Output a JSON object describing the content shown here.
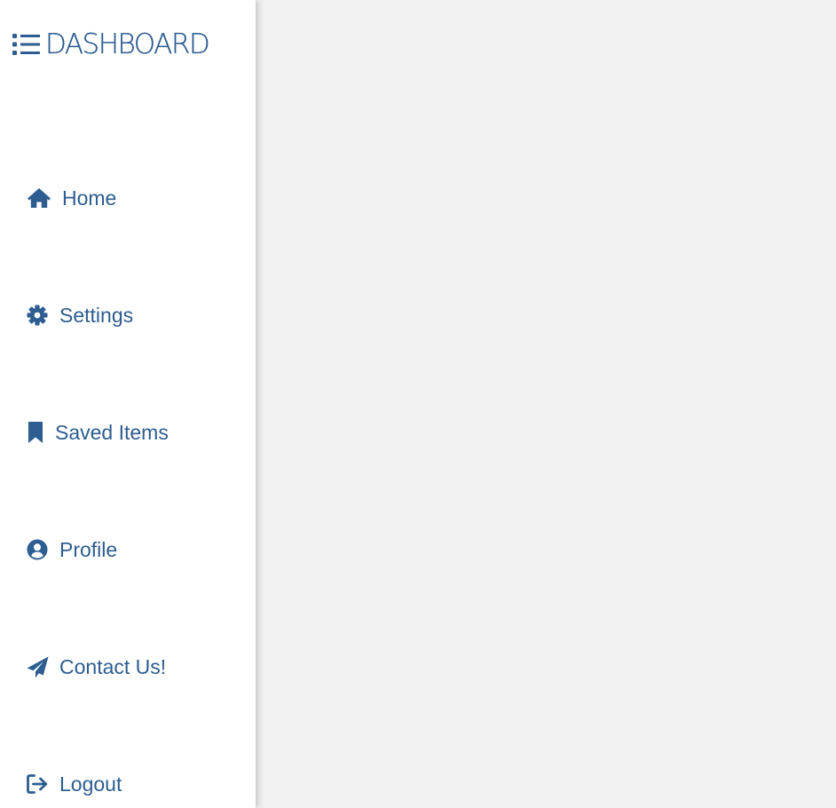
{
  "brand": {
    "title": "DASHBOARD",
    "icon": "list-icon"
  },
  "sidebar": {
    "items": [
      {
        "label": "Home",
        "icon": "home-icon"
      },
      {
        "label": "Settings",
        "icon": "gear-icon"
      },
      {
        "label": "Saved Items",
        "icon": "bookmark-icon"
      },
      {
        "label": "Profile",
        "icon": "user-circle-icon"
      },
      {
        "label": "Contact Us!",
        "icon": "paper-plane-icon"
      },
      {
        "label": "Logout",
        "icon": "logout-icon"
      }
    ]
  },
  "colors": {
    "accent": "#2d5d91",
    "sidebar_bg": "#ffffff",
    "main_bg": "#f2f2f2"
  }
}
